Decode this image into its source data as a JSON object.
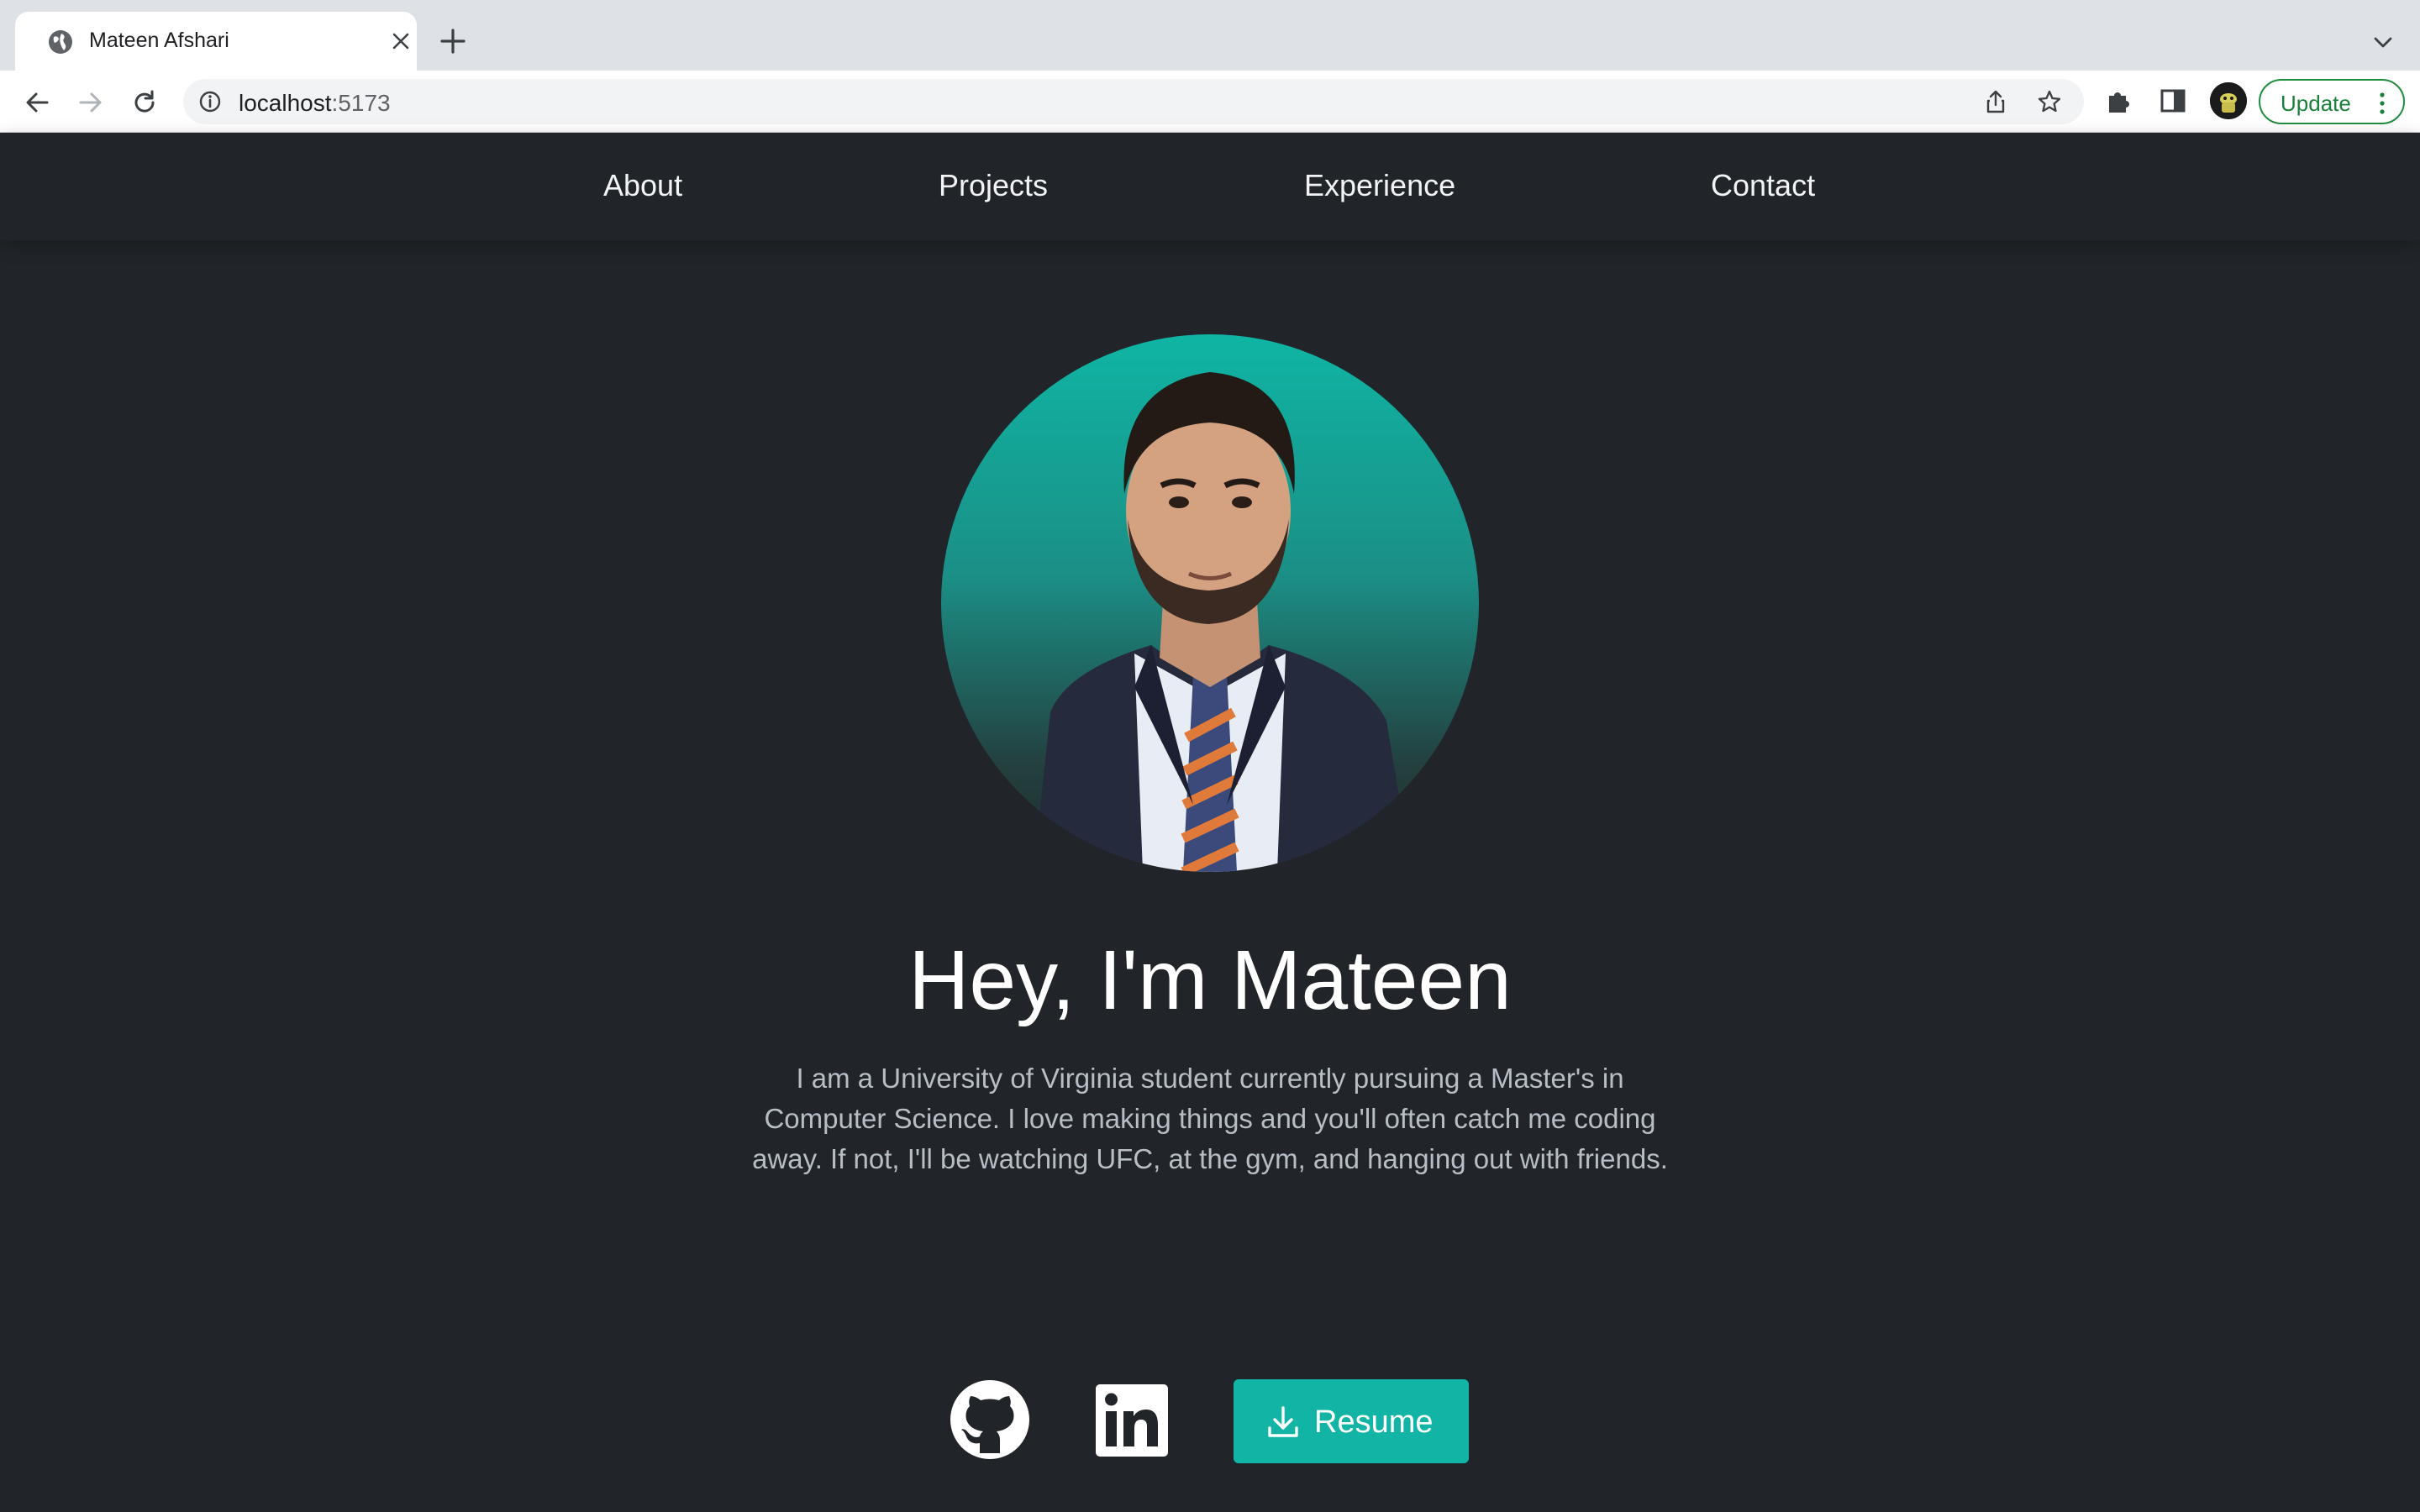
{
  "browser": {
    "tab_title": "Mateen Afshari",
    "url_host": "localhost",
    "url_port": ":5173",
    "update_label": "Update"
  },
  "nav": {
    "items": [
      {
        "label": "About"
      },
      {
        "label": "Projects"
      },
      {
        "label": "Experience"
      },
      {
        "label": "Contact"
      }
    ]
  },
  "hero": {
    "headline": "Hey, I'm Mateen",
    "bio": "I am a University of Virginia student currently pursuing a Master's in Computer Science. I love making things and you'll often catch me coding away. If not, I'll be watching UFC, at the gym, and hanging out with friends.",
    "resume_label": "Resume",
    "social_icons": [
      "github-icon",
      "linkedin-icon"
    ]
  },
  "colors": {
    "background": "#212529",
    "accent": "#12b5a5",
    "text": "#ffffff",
    "muted_text": "#b7bec6"
  }
}
